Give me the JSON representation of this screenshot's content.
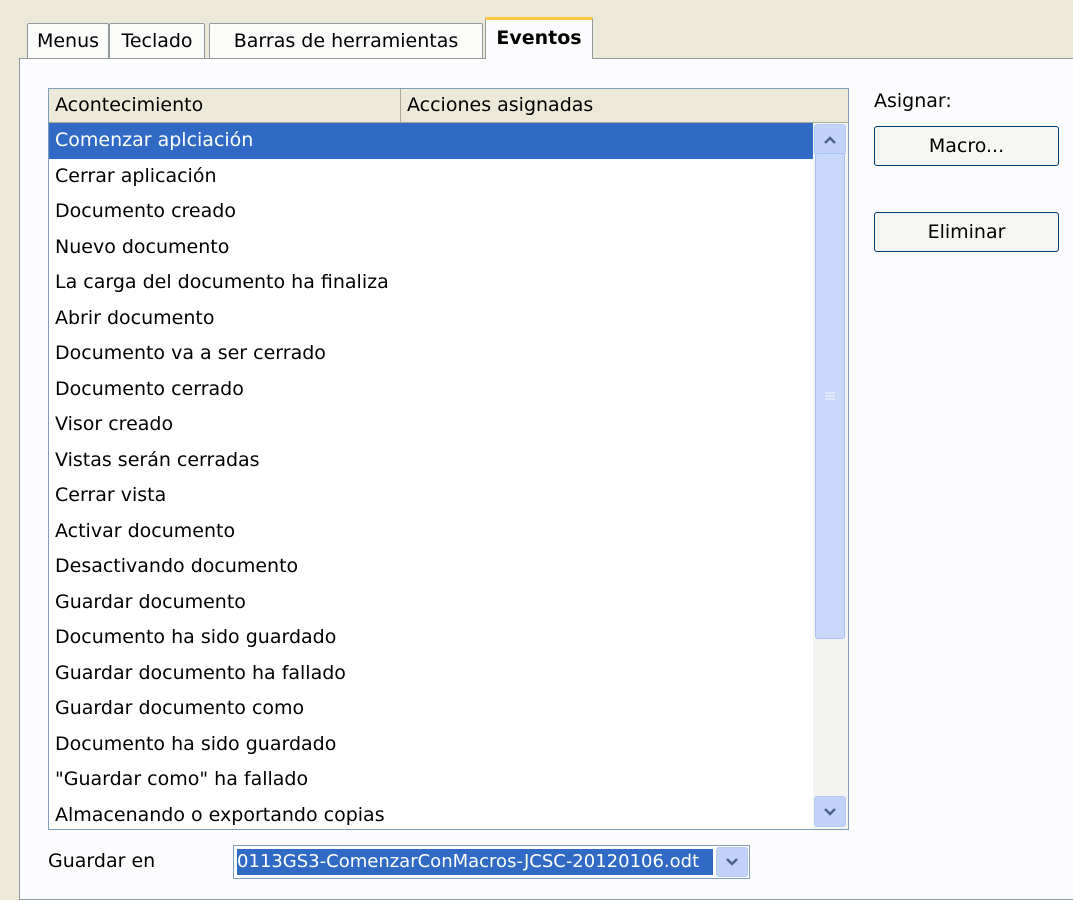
{
  "tabs": [
    {
      "label": "Menus"
    },
    {
      "label": "Teclado"
    },
    {
      "label": "Barras de herramientas"
    },
    {
      "label": "Eventos",
      "active": true
    }
  ],
  "events_list": {
    "columns": [
      "Acontecimiento",
      "Acciones asignadas"
    ],
    "rows": [
      "Comenzar aplciación",
      "Cerrar aplicación",
      "Documento creado",
      "Nuevo documento",
      "La carga del documento ha finaliza",
      "Abrir documento",
      "Documento va a ser cerrado",
      "Documento cerrado",
      "Visor creado",
      "Vistas serán cerradas",
      "Cerrar vista",
      "Activar documento",
      "Desactivando documento",
      "Guardar documento",
      "Documento ha sido guardado",
      "Guardar documento ha fallado",
      "Guardar documento como",
      "Documento ha sido guardado",
      "\"Guardar como\" ha fallado",
      "Almacenando o exportando copias"
    ],
    "selected_index": 0
  },
  "assign": {
    "label": "Asignar:",
    "macro_button": "Macro...",
    "delete_button": "Eliminar"
  },
  "save_in": {
    "label": "Guardar en",
    "value": "0113GS3-ComenzarConMacros-JCSC-20120106.odt"
  },
  "icons": [
    "scroll-up-icon",
    "scroll-down-icon",
    "grip-icon",
    "chevron-down-icon"
  ],
  "colors": {
    "selection": "#316ac5",
    "tab_highlight": "#ffc83c",
    "scroll": "#c1d3fb"
  }
}
